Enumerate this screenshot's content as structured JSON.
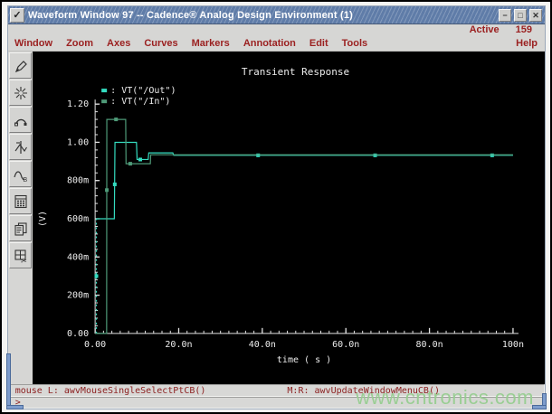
{
  "window": {
    "title": "Waveform Window 97 -- Cadence® Analog Design Environment (1)",
    "menu_button_glyph": "✓",
    "minimize_glyph": "−",
    "maximize_glyph": "□",
    "close_glyph": "✕"
  },
  "active_bar": {
    "label": "Active",
    "value": "159"
  },
  "menubar": {
    "items": [
      "Window",
      "Zoom",
      "Axes",
      "Curves",
      "Markers",
      "Annotation",
      "Edit",
      "Tools"
    ],
    "help": "Help"
  },
  "toolbar": {
    "icons": [
      "pen-icon",
      "zoom-star-icon",
      "arc-probe-icon",
      "vertical-marker-icon",
      "horizontal-marker-icon",
      "calculator-icon",
      "copy-window-icon",
      "cut-window-icon"
    ]
  },
  "chart_data": {
    "type": "line",
    "title": "Transient Response",
    "xlabel": "time ( s )",
    "ylabel": "(V)",
    "x_unit": "ns",
    "xlim": [
      0,
      100
    ],
    "ylim": [
      0,
      1.2
    ],
    "grid": false,
    "legend_position": "top-left",
    "xticks": [
      {
        "label": "0.00",
        "v": 0
      },
      {
        "label": "20.0n",
        "v": 20
      },
      {
        "label": "40.0n",
        "v": 40
      },
      {
        "label": "60.0n",
        "v": 60
      },
      {
        "label": "80.0n",
        "v": 80
      },
      {
        "label": "100n",
        "v": 100
      }
    ],
    "yticks": [
      {
        "label": "0.00",
        "v": 0
      },
      {
        "label": "200m",
        "v": 0.2
      },
      {
        "label": "400m",
        "v": 0.4
      },
      {
        "label": "600m",
        "v": 0.6
      },
      {
        "label": "800m",
        "v": 0.8
      },
      {
        "label": "1.00",
        "v": 1.0
      },
      {
        "label": "1.20",
        "v": 1.2
      }
    ],
    "x_minor_step": 2,
    "y_minor_step": 0.04,
    "series": [
      {
        "name": "VT(\"/Out\")",
        "color": "#34dcc0",
        "segments": [
          {
            "dash": true,
            "points": [
              [
                0.3,
                0
              ],
              [
                0.3,
                0.6
              ]
            ]
          },
          {
            "dash": false,
            "points": [
              [
                0.3,
                0.6
              ],
              [
                4.6,
                0.6
              ],
              [
                4.75,
                1.0
              ],
              [
                9.9,
                1.0
              ],
              [
                10.05,
                0.91
              ],
              [
                12.7,
                0.91
              ],
              [
                12.85,
                0.945
              ],
              [
                18.6,
                0.945
              ],
              [
                18.8,
                0.932
              ],
              [
                100,
                0.932
              ]
            ]
          }
        ],
        "markers": [
          [
            0.3,
            0.3
          ],
          [
            4.7,
            0.78
          ],
          [
            10.8,
            0.91
          ],
          [
            39,
            0.932
          ],
          [
            67,
            0.932
          ],
          [
            95,
            0.932
          ]
        ]
      },
      {
        "name": "VT(\"/In\")",
        "color": "#4e9a78",
        "segments": [
          {
            "dash": false,
            "points": [
              [
                0,
                0
              ],
              [
                2.75,
                0
              ],
              [
                2.8,
                1.12
              ],
              [
                7.3,
                1.12
              ],
              [
                7.4,
                0.888
              ],
              [
                13.2,
                0.888
              ],
              [
                13.3,
                0.935
              ],
              [
                100,
                0.935
              ]
            ]
          }
        ],
        "markers": [
          [
            2.8,
            0.75
          ],
          [
            5.0,
            1.12
          ],
          [
            8.4,
            0.888
          ]
        ]
      }
    ]
  },
  "statusbar": {
    "mouse_left": "mouse L: awvMouseSingleSelectPtCB()",
    "mouse_middle": "M:",
    "mouse_right": "R: awvUpdateWindowMenuCB()",
    "prompt": ">"
  },
  "watermark": "www.cntronics.com"
}
